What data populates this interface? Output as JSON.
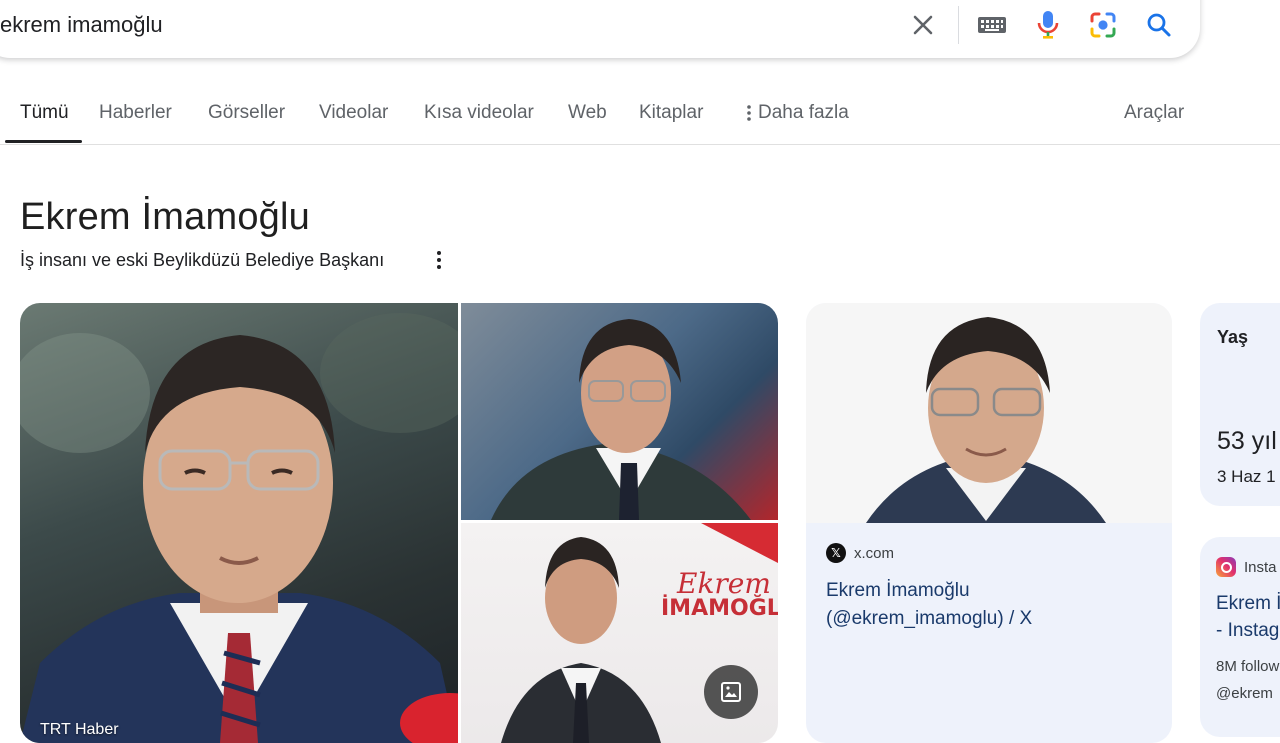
{
  "search": {
    "query": "ekrem imamoğlu",
    "icons": [
      "close-icon",
      "keyboard-icon",
      "mic-icon",
      "lens-icon",
      "search-icon"
    ]
  },
  "tabs": [
    {
      "label": "Tümü",
      "active": true
    },
    {
      "label": "Haberler"
    },
    {
      "label": "Görseller"
    },
    {
      "label": "Videolar"
    },
    {
      "label": "Kısa videolar"
    },
    {
      "label": "Web"
    },
    {
      "label": "Kitaplar"
    }
  ],
  "more_label": "Daha fazla",
  "tools_label": "Araçlar",
  "entity": {
    "title": "Ekrem İmamoğlu",
    "subtitle": "İş insanı ve eski Beylikdüzü Belediye Başkanı"
  },
  "images": {
    "main_source": "TRT Haber",
    "poster_text_top": "Ekrem",
    "poster_text_bottom": "İMAMOĞLU"
  },
  "x_card": {
    "site": "x.com",
    "title_line1": "Ekrem İmamoğlu",
    "title_line2": "(@ekrem_imamoglu) / X"
  },
  "age_card": {
    "label": "Yaş",
    "value": "53 yıl",
    "date": "3 Haz 1"
  },
  "ig_card": {
    "site": "Insta",
    "title_line1": "Ekrem İ",
    "title_line2": "- Instag",
    "followers": "8M follow",
    "handle": "@ekrem"
  },
  "colors": {
    "accent_blue": "#1a73e8",
    "card_bg": "#eef2fb",
    "link_text": "#1a3a6b"
  }
}
